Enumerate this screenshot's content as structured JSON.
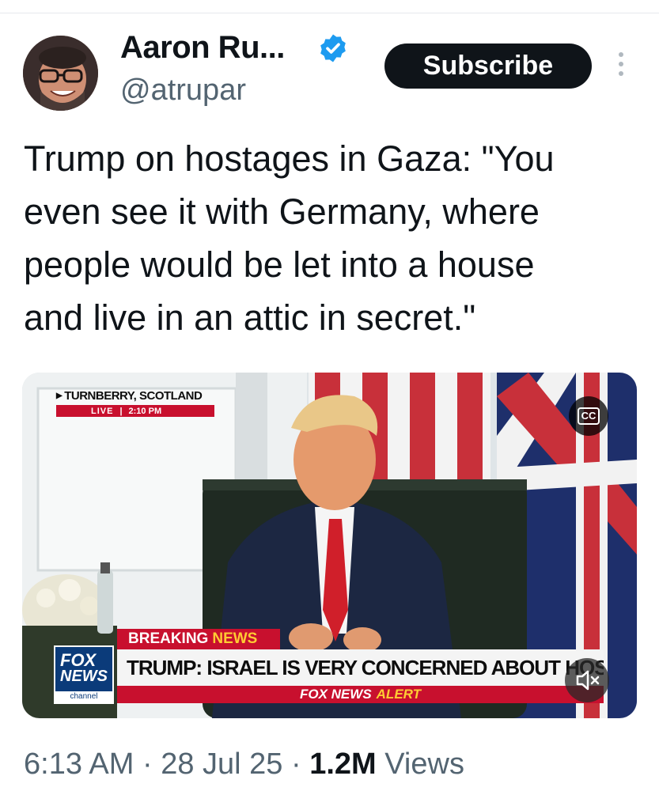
{
  "author": {
    "name": "Aaron Ru...",
    "handle": "@atrupar",
    "verified": true,
    "verified_color": "#1d9bf0"
  },
  "actions": {
    "subscribe_label": "Subscribe",
    "more_icon": "more-vertical-icon"
  },
  "tweet": {
    "lines": [
      "Trump on hostages in Gaza: \"You",
      "even see it with Germany, where",
      "people would be let into a house",
      "and live in an attic in secret.\""
    ]
  },
  "video": {
    "location": "TURNBERRY, SCOTLAND",
    "live_label": "LIVE",
    "live_time": "2:10 PM",
    "cc_label": "CC",
    "logo_line1": "FOX",
    "logo_line2": "NEWS",
    "logo_line3": "channel",
    "breaking_word": "BREAKING",
    "news_word": "NEWS",
    "headline": "TRUMP: ISRAEL IS VERY CONCERNED ABOUT HOSTAGES",
    "alert_prefix": "FOX NEWS",
    "alert_word": "ALERT",
    "mute_icon": "volume-muted-icon",
    "colors": {
      "fox_red": "#c8102e",
      "fox_blue": "#0b3b7a",
      "fox_yellow": "#ffcc33"
    }
  },
  "meta": {
    "time": "6:13 AM",
    "sep1": " · ",
    "date": "28 Jul 25",
    "sep2": " · ",
    "views_count": "1.2M",
    "views_label": " Views"
  }
}
